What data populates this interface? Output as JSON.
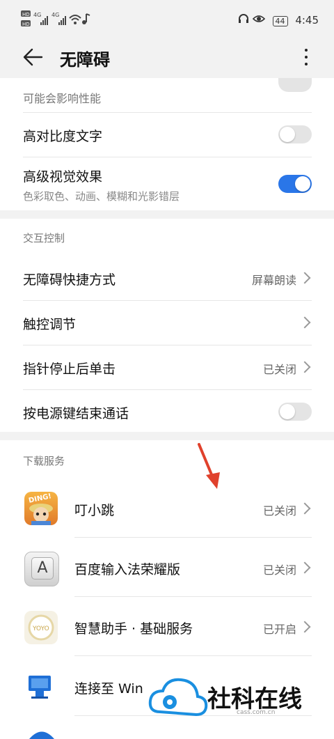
{
  "status": {
    "left_icons": "HD 4G 4G",
    "battery": "44",
    "time": "4:45"
  },
  "header": {
    "title": "无障碍"
  },
  "top_card": {
    "partial_text": "可能会影响性能",
    "high_contrast_label": "高对比度文字",
    "high_contrast_on": false,
    "advanced_visual_label": "高级视觉效果",
    "advanced_visual_sub": "色彩取色、动画、模糊和光影错层",
    "advanced_visual_on": true
  },
  "interaction": {
    "section_title": "交互控制",
    "shortcut_label": "无障碍快捷方式",
    "shortcut_value": "屏幕朗读",
    "touch_label": "触控调节",
    "pointer_label": "指针停止后单击",
    "pointer_value": "已关闭",
    "power_label": "按电源键结束通话",
    "power_on": false
  },
  "downloads": {
    "section_title": "下载服务",
    "items": [
      {
        "label": "叮小跳",
        "value": "已关闭",
        "icon": "dingxiaotiao-app-icon"
      },
      {
        "label": "百度输入法荣耀版",
        "value": "已关闭",
        "icon": "baidu-input-app-icon"
      },
      {
        "label": "智慧助手 · 基础服务",
        "value": "已开启",
        "icon": "yoyo-assistant-app-icon"
      },
      {
        "label": "连接至 Win",
        "value": "",
        "icon": "connect-windows-app-icon"
      }
    ]
  },
  "icon_dingxiaotiao_text": "DING!",
  "icon_baidu_letter": "A",
  "icon_yoyo_text": "YOYO",
  "watermark": {
    "text": "社科在线",
    "sub": "cass.com.cn"
  },
  "colors": {
    "accent": "#2a76e8",
    "annotation_arrow": "#e0412c"
  }
}
